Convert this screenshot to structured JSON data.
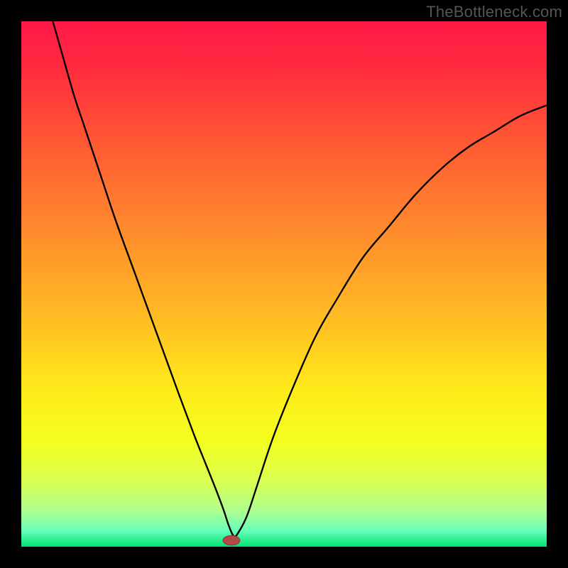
{
  "watermark": "TheBottleneck.com",
  "colors": {
    "frame": "#000000",
    "gradient_stops": [
      {
        "offset": 0.0,
        "color": "#ff1946"
      },
      {
        "offset": 0.09,
        "color": "#ff2b3e"
      },
      {
        "offset": 0.2,
        "color": "#ff4f35"
      },
      {
        "offset": 0.32,
        "color": "#ff7430"
      },
      {
        "offset": 0.45,
        "color": "#ff9a2a"
      },
      {
        "offset": 0.58,
        "color": "#ffc122"
      },
      {
        "offset": 0.7,
        "color": "#ffea1a"
      },
      {
        "offset": 0.8,
        "color": "#f4ff1e"
      },
      {
        "offset": 0.88,
        "color": "#d6ff55"
      },
      {
        "offset": 0.93,
        "color": "#b0ff8e"
      },
      {
        "offset": 0.97,
        "color": "#66ffb8"
      },
      {
        "offset": 1.0,
        "color": "#00e36f"
      }
    ],
    "curve": "#000000",
    "marker_fill": "#b24a4a",
    "marker_stroke": "#8e3636"
  },
  "chart_data": {
    "type": "line",
    "title": "",
    "xlabel": "",
    "ylabel": "",
    "xlim": [
      0,
      100
    ],
    "ylim": [
      0,
      100
    ],
    "grid": false,
    "legend": null,
    "series": [
      {
        "name": "bottleneck-curve",
        "x": [
          6,
          8,
          10,
          12,
          15,
          18,
          22,
          26,
          30,
          33,
          35,
          37,
          38.5,
          39.5,
          40.5,
          41.5,
          43,
          45,
          48,
          52,
          56,
          60,
          65,
          70,
          75,
          80,
          85,
          90,
          95,
          100
        ],
        "y": [
          100,
          93,
          86,
          80,
          71,
          62,
          51,
          40,
          29,
          21,
          16,
          11,
          7,
          4,
          2,
          3,
          6,
          12,
          21,
          31,
          40,
          47,
          55,
          61,
          67,
          72,
          76,
          79,
          82,
          84
        ]
      }
    ],
    "marker": {
      "x": 40,
      "y": 1.2,
      "rx": 1.6,
      "ry": 0.9
    },
    "notes": "y ≈ bottleneck percentage; minimum at x ≈ 40 where bottleneck ≈ 0. Left branch falls nearly linearly from 100; right branch rises with diminishing slope toward ~84–85."
  }
}
